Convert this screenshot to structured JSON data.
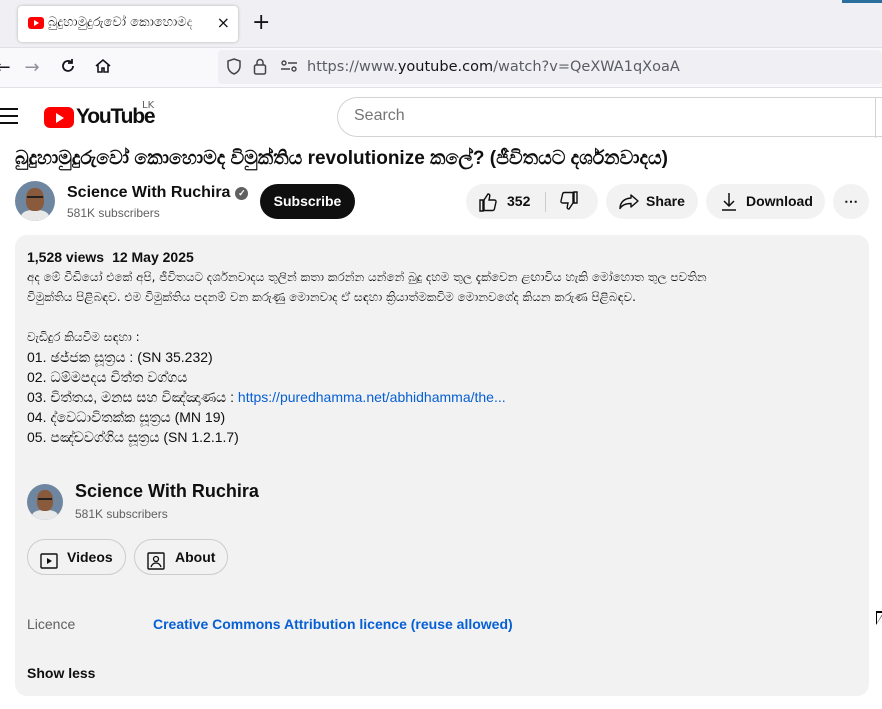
{
  "browser": {
    "tab_title": "බුදුහාමුදුරුවෝ කොහොමද",
    "tab_close": "×",
    "new_tab": "+",
    "url_prefix": "https://www.",
    "url_domain": "youtube.com",
    "url_path": "/watch?v=QeXWA1qXoaA"
  },
  "youtube": {
    "logo_text": "YouTube",
    "country_code": "LK",
    "search_placeholder": "Search"
  },
  "video": {
    "title": "බුදුහාමුදුරුවෝ කොහොමද විමුක්තිය revolutionize කලේ? (ජීවිතයට දර්ශනවාදය)",
    "channel_name": "Science With Ruchira",
    "channel_subscribers": "581K subscribers",
    "subscribe_label": "Subscribe",
    "likes": "352",
    "share_label": "Share",
    "download_label": "Download",
    "more_label": "⋯"
  },
  "description": {
    "views": "1,528 views",
    "date": "12 May 2025",
    "line1": "අද මේ වීඩියෝ එකේ අපි, ජීවිතයට දර්ශනවාදය තුලින් කතා කරන්න යන්නේ බුදු දහම තුල දැක්වෙන ළඟාවිය හැකි මෝහොත තුල පවතින",
    "line2": "විමුක්තිය පිළිබඳව. එම විමුක්තිය පදනම් වන කරුණු මොනවාද ඒ සඳහා ක්‍රියාත්මකවිම මොනවගේද කියන කරුණ පිළිබඳව.",
    "refs_heading": "වැඩිදුර කියවීම සඳහා :",
    "ref1": "01. ඡජ්ජක සූත්‍රය : (SN 35.232)",
    "ref2": "02. ධම්මපදය චිත්ත වග්ගය",
    "ref3_prefix": "03. චිත්තය, මනස සහ විඤ්ඤාණය : ",
    "ref3_link": "https://puredhamma.net/abhidhamma/the...",
    "ref4": "04. ද්වෙධාවිතක්ක සූත්‍රය (MN 19)",
    "ref5": "05. පඤ්චවග්ගිය සූත්‍රය (SN 1.2.1.7)",
    "card_channel_name": "Science With Ruchira",
    "card_subscribers": "581K subscribers",
    "videos_label": "Videos",
    "about_label": "About",
    "licence_label": "Licence",
    "licence_value": "Creative Commons Attribution licence (reuse allowed)",
    "show_less": "Show less"
  }
}
